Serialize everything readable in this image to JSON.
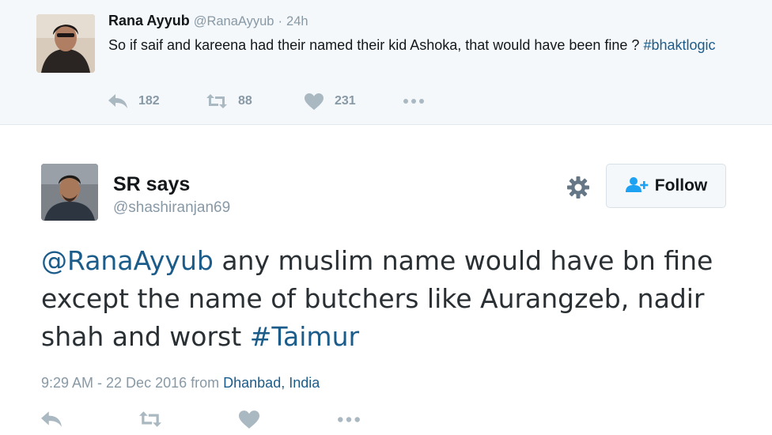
{
  "parent_tweet": {
    "name": "Rana Ayyub",
    "handle": "@RanaAyyub",
    "separator": "·",
    "time": "24h",
    "text_plain": "So if saif and kareena had their named their kid Ashoka, that would have been fine ? ",
    "hashtag": "#bhaktlogic",
    "actions": {
      "reply_count": "182",
      "retweet_count": "88",
      "like_count": "231"
    }
  },
  "main_tweet": {
    "name": "SR says",
    "handle": "@shashiranjan69",
    "follow_label": "Follow",
    "mention": "@RanaAyyub",
    "text_plain": " any muslim name would have bn fine except the name of butchers like Aurangzeb, nadir shah and worst ",
    "hashtag": "#Taimur",
    "meta": {
      "timestamp": "9:29 AM - 22 Dec 2016",
      "from_label": " from ",
      "place": "Dhanbad, India"
    }
  },
  "colors": {
    "link": "#1b5c8a",
    "muted": "#8899a6",
    "parent_background": "#f5f8fa",
    "icon": "#aab8c2"
  },
  "icons": [
    "reply-icon",
    "retweet-icon",
    "like-icon",
    "more-icon",
    "gear-icon",
    "follow-person-plus-icon"
  ]
}
